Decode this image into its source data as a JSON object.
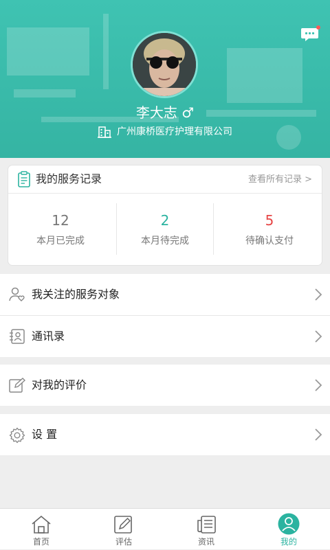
{
  "profile": {
    "name": "李大志 ♂",
    "company": "广州康桥医疗护理有限公司"
  },
  "service_card": {
    "title": "我的服务记录",
    "link": "查看所有记录 >",
    "stats": [
      {
        "value": "12",
        "label": "本月已完成",
        "color": "#777777"
      },
      {
        "value": "2",
        "label": "本月待完成",
        "color": "#2bb3a0"
      },
      {
        "value": "5",
        "label": "待确认支付",
        "color": "#e64545"
      }
    ]
  },
  "menu": {
    "followed": "我关注的服务对象",
    "contacts": "通讯录",
    "reviews": "对我的评价",
    "settings": "设 置"
  },
  "tabs": [
    {
      "label": "首页",
      "icon": "home-icon"
    },
    {
      "label": "评估",
      "icon": "edit-icon"
    },
    {
      "label": "资讯",
      "icon": "news-icon"
    },
    {
      "label": "我的",
      "icon": "profile-icon"
    }
  ],
  "colors": {
    "accent": "#2bb3a0",
    "header": "#3fc3b2",
    "pending_payment": "#e64545"
  }
}
